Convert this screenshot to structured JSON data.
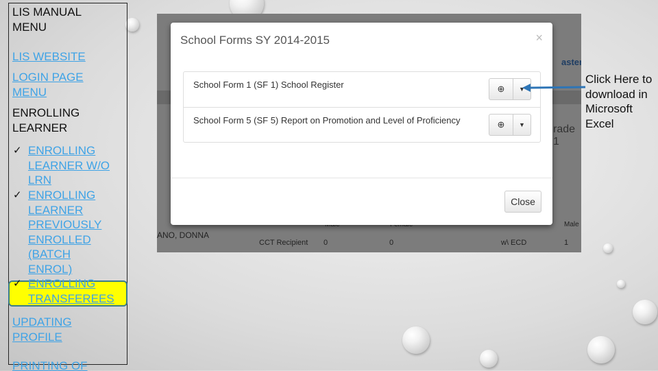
{
  "menu": {
    "title": [
      "LIS MANUAL",
      "MENU"
    ],
    "lis_website": "LIS WEBSITE",
    "login_page": [
      "LOGIN PAGE",
      "MENU"
    ],
    "enrolling_learner": [
      "ENROLLING",
      "LEARNER"
    ],
    "sub_items": [
      {
        "lines": [
          "ENROLLING",
          "LEARNER W/O",
          "LRN"
        ]
      },
      {
        "lines": [
          "ENROLLING",
          "LEARNER",
          "PREVIOUSLY",
          "ENROLLED",
          "(BATCH",
          "ENROL)"
        ]
      },
      {
        "lines": [
          "ENROLLING",
          "TRANSFEREES"
        ],
        "highlighted": true
      }
    ],
    "check": "✓",
    "updating_profile": [
      "UPDATING",
      "PROFILE"
    ],
    "printing_of": "PRINTING OF"
  },
  "screenshot": {
    "modal": {
      "title": "School Forms SY 2014-2015",
      "close_x": "×",
      "forms": [
        "School Form 1 (SF 1) School Register",
        "School Form 5 (SF 5) Report on Promotion and Level of Proficiency"
      ],
      "download_icon": "⊕",
      "caret": "▼",
      "close_button": "Close"
    },
    "background": {
      "masterlist": "asterli",
      "grade": "rade 1",
      "name": "ANO, DONNA",
      "male": "Male",
      "female": "Female",
      "cct": "CCT Recipient",
      "cct_male": "0",
      "cct_female": "0",
      "ecd": "w\\ ECD",
      "ecd_male": "1",
      "male2": "Male"
    }
  },
  "callout": {
    "text": "Click Here to download in Microsoft Excel",
    "arrow_color": "#2e75b6"
  },
  "colors": {
    "link": "#3fa3e6",
    "highlight": "#ffff00"
  }
}
